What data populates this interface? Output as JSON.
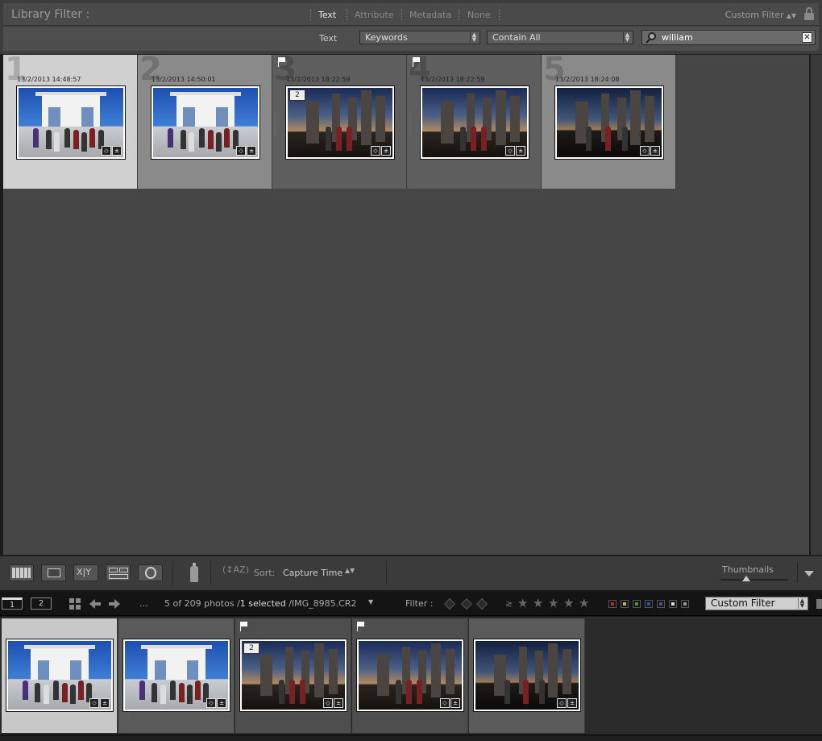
{
  "filter_bar": {
    "title": "Library Filter :",
    "tabs": [
      {
        "label": "Text",
        "active": true
      },
      {
        "label": "Attribute",
        "active": false
      },
      {
        "label": "Metadata",
        "active": false
      },
      {
        "label": "None",
        "active": false
      }
    ],
    "preset": "Custom Filter",
    "text_label": "Text",
    "field_select": "Keywords",
    "rule_select": "Contain All",
    "search_value": "william"
  },
  "grid": {
    "cells": [
      {
        "index": "1",
        "date": "13/2/2013 14:48:57",
        "selected": true,
        "flag": false,
        "stack": "",
        "scene": "gate"
      },
      {
        "index": "2",
        "date": "13/2/2013 14:50:01",
        "selected": false,
        "flag": false,
        "stack": "",
        "scene": "gate"
      },
      {
        "index": "3",
        "date": "13/2/2013 18:22:59",
        "selected": false,
        "flag": true,
        "stack": "2",
        "scene": "dusk"
      },
      {
        "index": "4",
        "date": "13/2/2013 18:22:59",
        "selected": false,
        "flag": true,
        "stack": "",
        "scene": "dusk"
      },
      {
        "index": "5",
        "date": "13/2/2013 18:24:08",
        "selected": false,
        "flag": false,
        "stack": "",
        "scene": "dusk2"
      }
    ]
  },
  "toolbar": {
    "sort_label": "Sort:",
    "sort_value": "Capture Time",
    "thumbnails_label": "Thumbnails",
    "thumbnails_level": 0.38
  },
  "filmstrip_header": {
    "screen1": "1",
    "screen2": "2",
    "path_ellipsis": "...",
    "count_prefix": "5 of 209 photos /",
    "selected_text": "1 selected",
    "filename": "/IMG_8985.CR2",
    "filter_label": "Filter :",
    "ge_symbol": "≥",
    "stars": [
      "★",
      "★",
      "★",
      "★",
      "★"
    ],
    "color_labels": [
      "#c2272d",
      "#c9b41c",
      "#3a9a3a",
      "#3051b0",
      "#6a3fa0",
      "#e0e0e0",
      "#9a9a9a"
    ],
    "filter_preset": "Custom Filter"
  },
  "filmstrip": {
    "items": [
      {
        "scene": "gate",
        "flag": false,
        "stack": "",
        "selected": true
      },
      {
        "scene": "gate",
        "flag": false,
        "stack": "",
        "selected": false
      },
      {
        "scene": "dusk",
        "flag": true,
        "stack": "2",
        "selected": false
      },
      {
        "scene": "dusk",
        "flag": true,
        "stack": "",
        "selected": false
      },
      {
        "scene": "dusk2",
        "flag": false,
        "stack": "",
        "selected": false
      }
    ]
  }
}
